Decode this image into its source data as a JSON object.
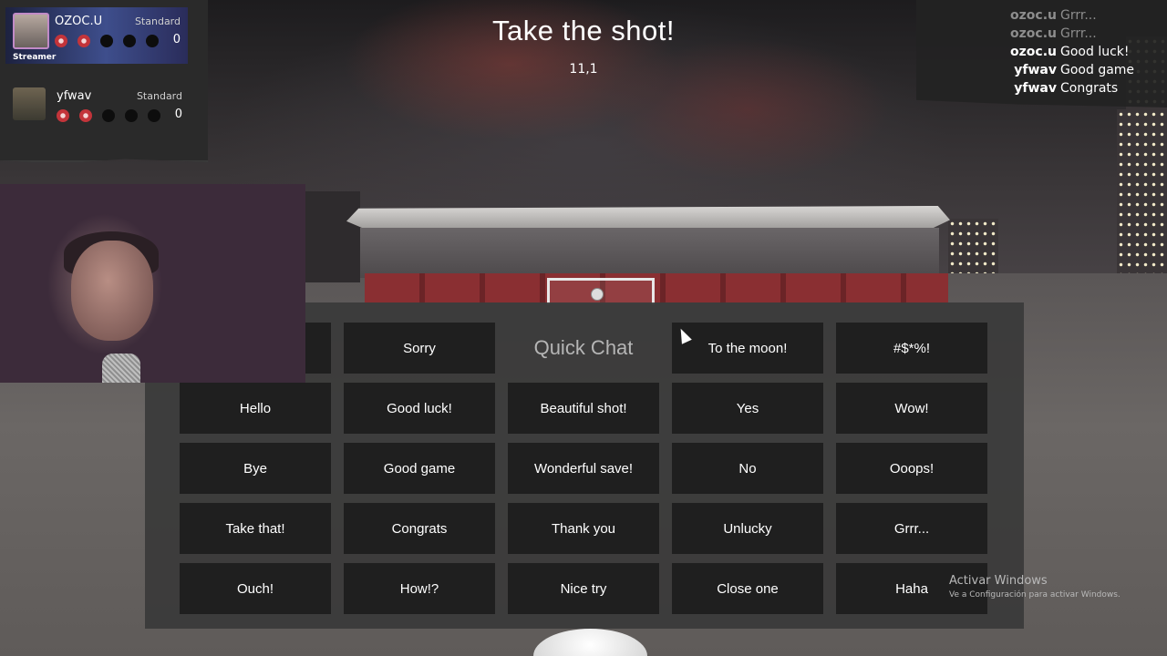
{
  "header": {
    "title": "Take the shot!",
    "subtitle": "11,1"
  },
  "scoreboard": {
    "players": [
      {
        "name": "OZOC.U",
        "mode": "Standard",
        "score": "0",
        "badge": "Streamer",
        "shots": [
          "miss",
          "miss",
          "empty",
          "empty",
          "empty"
        ]
      },
      {
        "name": "yfwav",
        "mode": "Standard",
        "score": "0",
        "shots": [
          "miss",
          "miss",
          "empty",
          "empty",
          "empty"
        ]
      }
    ]
  },
  "chat_feed": [
    {
      "user": "ozoc.u",
      "message": "Grrr...",
      "faded": true
    },
    {
      "user": "ozoc.u",
      "message": "Grrr...",
      "faded": true
    },
    {
      "user": "ozoc.u",
      "message": "Good luck!",
      "faded": false
    },
    {
      "user": "yfwav",
      "message": "Good game",
      "faded": false
    },
    {
      "user": "yfwav",
      "message": "Congrats",
      "faded": false
    }
  ],
  "quick_chat": {
    "title": "Quick Chat",
    "rows": [
      [
        "",
        "Sorry",
        "",
        "To the moon!",
        "#$*%!"
      ],
      [
        "Hello",
        "Good luck!",
        "Beautiful shot!",
        "Yes",
        "Wow!"
      ],
      [
        "Bye",
        "Good game",
        "Wonderful save!",
        "No",
        "Ooops!"
      ],
      [
        "Take that!",
        "Congrats",
        "Thank you",
        "Unlucky",
        "Grrr..."
      ],
      [
        "Ouch!",
        "How!?",
        "Nice try",
        "Close one",
        "Haha"
      ]
    ]
  },
  "watermark": {
    "line1": "Activar Windows",
    "line2": "Ve a Configuración para activar Windows."
  },
  "colors": {
    "miss": "#c3343a",
    "panel": "#3a3a3a",
    "button": "#1f1f1f"
  }
}
